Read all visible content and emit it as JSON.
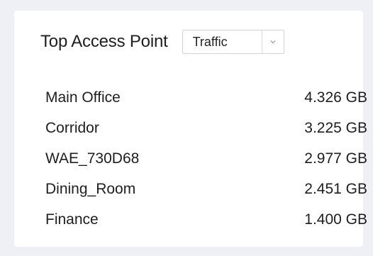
{
  "panel": {
    "title": "Top Access Point",
    "dropdown": {
      "selected": "Traffic",
      "toggle_icon": "chevron-down-icon"
    },
    "rows": [
      {
        "name": "Main Office",
        "value": "4.326 GB"
      },
      {
        "name": "Corridor",
        "value": "3.225 GB"
      },
      {
        "name": "WAE_730D68",
        "value": "2.977 GB"
      },
      {
        "name": "Dining_Room",
        "value": "2.451 GB"
      },
      {
        "name": "Finance",
        "value": "1.400 GB"
      }
    ]
  }
}
